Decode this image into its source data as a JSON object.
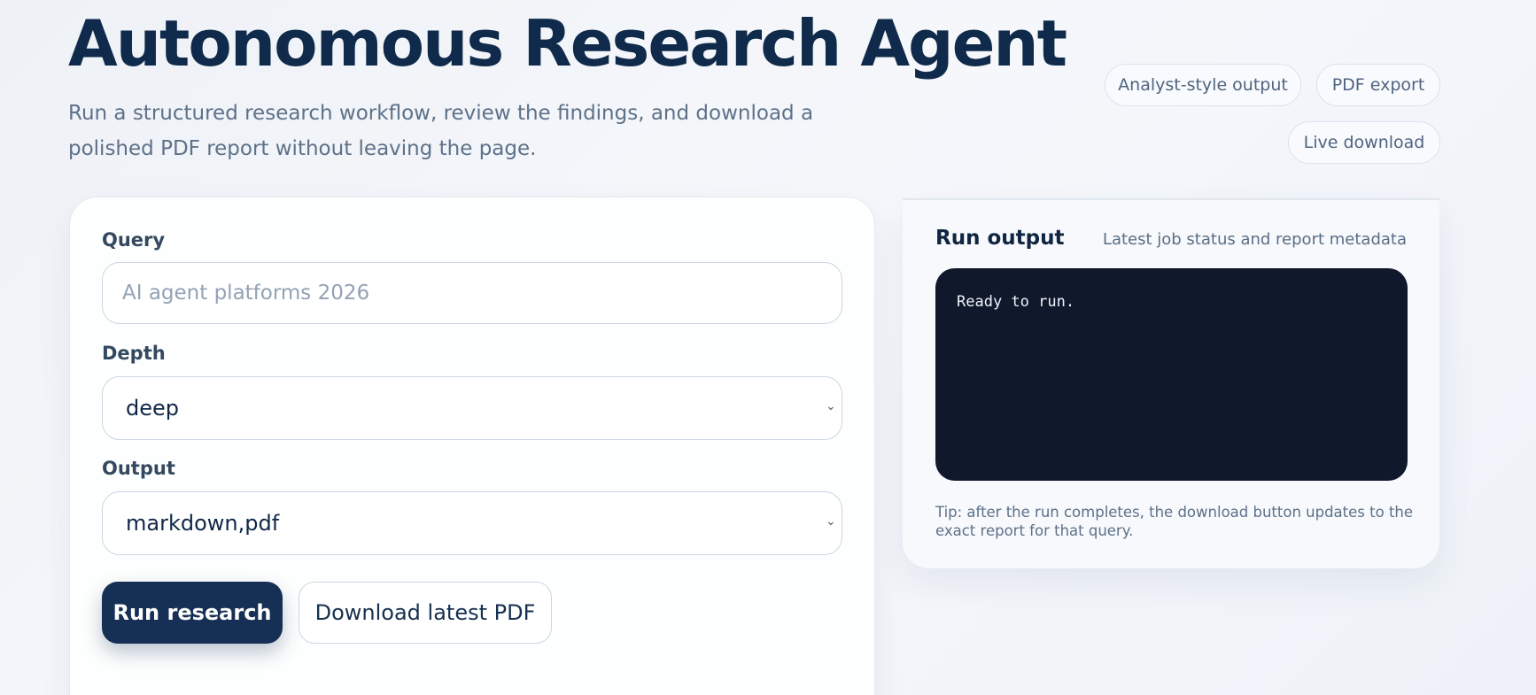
{
  "header": {
    "title": "Autonomous Research Agent",
    "subtitle": "Run a structured research workflow, review the findings, and download a polished PDF report without leaving the page."
  },
  "chips": [
    "Analyst-style output",
    "PDF export",
    "Live download"
  ],
  "form": {
    "query_label": "Query",
    "query_placeholder": "AI agent platforms 2026",
    "depth_label": "Depth",
    "depth_value": "deep",
    "output_label": "Output",
    "output_value": "markdown,pdf",
    "run_button": "Run research",
    "download_button": "Download latest PDF"
  },
  "output": {
    "title": "Run output",
    "subtitle": "Latest job status and report metadata",
    "console_text": "Ready to run.",
    "tip": "Tip: after the run completes, the download button updates to the exact report for that query."
  },
  "colors": {
    "primary": "#163055",
    "console_bg": "#10192b",
    "muted_text": "#5d7189"
  }
}
